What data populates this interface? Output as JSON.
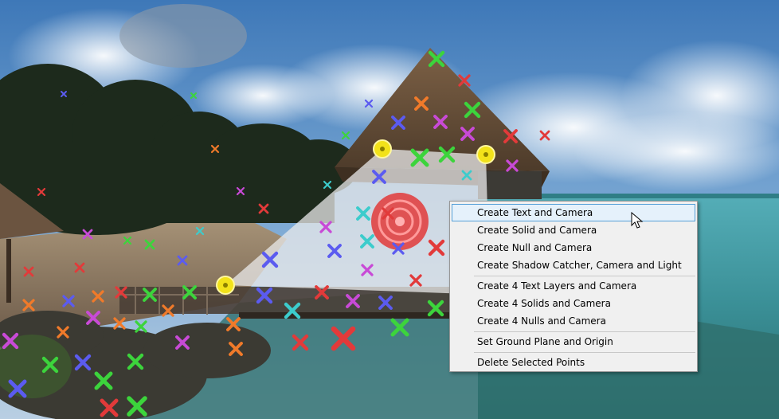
{
  "context_menu": {
    "items": [
      {
        "label": "Create Text and Camera",
        "highlighted": true
      },
      {
        "label": "Create Solid and Camera"
      },
      {
        "label": "Create Null and Camera"
      },
      {
        "label": "Create Shadow Catcher, Camera and Light"
      },
      {
        "label": "Create 4 Text Layers and Camera"
      },
      {
        "label": "Create 4 Solids and Camera"
      },
      {
        "label": "Create 4 Nulls and Camera"
      },
      {
        "label": "Set Ground Plane and Origin"
      },
      {
        "label": "Delete Selected Points"
      }
    ]
  },
  "colors": {
    "highlight_bg": "#e5f1fb",
    "highlight_border": "#56a0d8",
    "target_red": "#e23a3a",
    "anchor_yellow": "#f2e21a"
  }
}
